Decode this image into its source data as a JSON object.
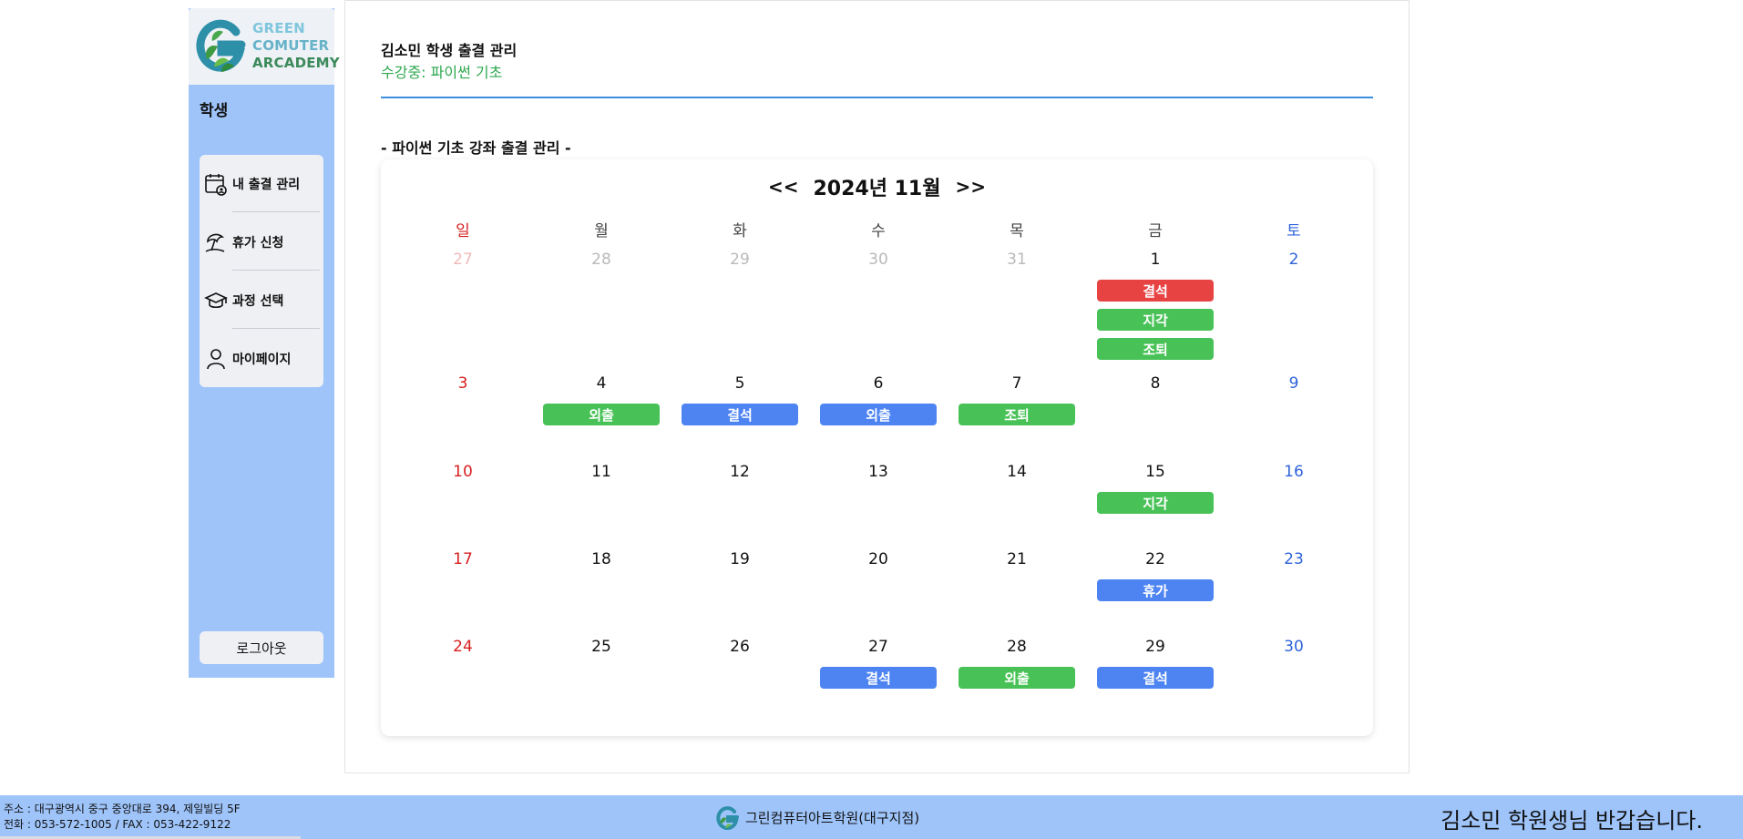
{
  "sidebar": {
    "logo_lines": [
      "GREEN",
      "COMUTER",
      "ARCADEMY"
    ],
    "title": "학생",
    "menu": [
      {
        "label": "내 출결 관리",
        "icon": "calendar-user-icon"
      },
      {
        "label": "휴가 신청",
        "icon": "beach-umbrella-icon"
      },
      {
        "label": "과정 선택",
        "icon": "graduation-cap-icon"
      },
      {
        "label": "마이페이지",
        "icon": "user-icon"
      }
    ],
    "logout_label": "로그아웃"
  },
  "main": {
    "page_title": "김소민 학생 출결 관리",
    "course_line": "수강중: 파이썬 기초",
    "section_title": "- 파이썬 기초 강좌 출결 관리 -"
  },
  "calendar": {
    "prev_label": "<<",
    "next_label": ">>",
    "month_label": "2024년 11월",
    "weekdays": [
      "일",
      "월",
      "화",
      "수",
      "목",
      "금",
      "토"
    ],
    "weeks": [
      [
        {
          "day": "27",
          "other": true,
          "events": []
        },
        {
          "day": "28",
          "other": true,
          "events": []
        },
        {
          "day": "29",
          "other": true,
          "events": []
        },
        {
          "day": "30",
          "other": true,
          "events": []
        },
        {
          "day": "31",
          "other": true,
          "events": []
        },
        {
          "day": "1",
          "other": false,
          "events": [
            {
              "label": "결석",
              "color": "#e74343"
            },
            {
              "label": "지각",
              "color": "#48c257"
            },
            {
              "label": "조퇴",
              "color": "#48c257"
            }
          ]
        },
        {
          "day": "2",
          "other": false,
          "events": []
        }
      ],
      [
        {
          "day": "3",
          "other": false,
          "events": []
        },
        {
          "day": "4",
          "other": false,
          "events": [
            {
              "label": "외출",
              "color": "#48c257"
            }
          ]
        },
        {
          "day": "5",
          "other": false,
          "events": [
            {
              "label": "결석",
              "color": "#4d84f2"
            }
          ]
        },
        {
          "day": "6",
          "other": false,
          "events": [
            {
              "label": "외출",
              "color": "#4d84f2"
            }
          ]
        },
        {
          "day": "7",
          "other": false,
          "events": [
            {
              "label": "조퇴",
              "color": "#48c257"
            }
          ]
        },
        {
          "day": "8",
          "other": false,
          "events": []
        },
        {
          "day": "9",
          "other": false,
          "events": []
        }
      ],
      [
        {
          "day": "10",
          "other": false,
          "events": []
        },
        {
          "day": "11",
          "other": false,
          "events": []
        },
        {
          "day": "12",
          "other": false,
          "events": []
        },
        {
          "day": "13",
          "other": false,
          "events": []
        },
        {
          "day": "14",
          "other": false,
          "events": []
        },
        {
          "day": "15",
          "other": false,
          "events": [
            {
              "label": "지각",
              "color": "#48c257"
            }
          ]
        },
        {
          "day": "16",
          "other": false,
          "events": []
        }
      ],
      [
        {
          "day": "17",
          "other": false,
          "events": []
        },
        {
          "day": "18",
          "other": false,
          "events": []
        },
        {
          "day": "19",
          "other": false,
          "events": []
        },
        {
          "day": "20",
          "other": false,
          "events": []
        },
        {
          "day": "21",
          "other": false,
          "events": []
        },
        {
          "day": "22",
          "other": false,
          "events": [
            {
              "label": "휴가",
              "color": "#4d84f2"
            }
          ]
        },
        {
          "day": "23",
          "other": false,
          "events": []
        }
      ],
      [
        {
          "day": "24",
          "other": false,
          "events": []
        },
        {
          "day": "25",
          "other": false,
          "events": []
        },
        {
          "day": "26",
          "other": false,
          "events": []
        },
        {
          "day": "27",
          "other": false,
          "events": [
            {
              "label": "결석",
              "color": "#4d84f2"
            }
          ]
        },
        {
          "day": "28",
          "other": false,
          "events": [
            {
              "label": "외출",
              "color": "#48c257"
            }
          ]
        },
        {
          "day": "29",
          "other": false,
          "events": [
            {
              "label": "결석",
              "color": "#4d84f2"
            }
          ]
        },
        {
          "day": "30",
          "other": false,
          "events": []
        }
      ]
    ]
  },
  "footer": {
    "address": "주소 : 대구광역시 중구 중앙대로 394, 제일빌딩 5F",
    "phone": "전화 : 053-572-1005 / FAX : 053-422-9122",
    "brand_name": "그린컴퓨터아트학원(대구지점)",
    "greeting": "김소민 학원생님 반갑습니다."
  },
  "colors": {
    "sidebar_bg": "#9ec4fa",
    "accent_line": "#3b8fdc",
    "course_green": "#2fa84f",
    "sunday": "#d62020",
    "saturday": "#2f63d8"
  }
}
